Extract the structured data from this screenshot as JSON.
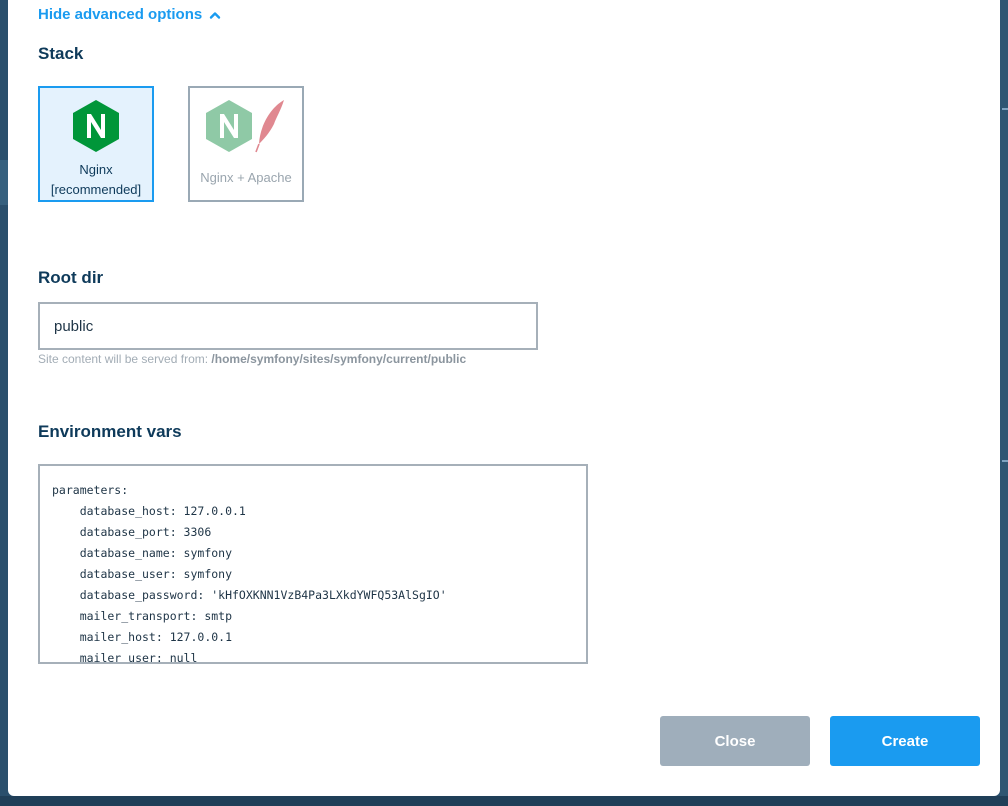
{
  "advanced_toggle": {
    "label": "Hide advanced options",
    "icon": "chevron-up-icon"
  },
  "stack": {
    "title": "Stack",
    "options": [
      {
        "label_line1": "Nginx",
        "label_line2": "[recommended]",
        "selected": true,
        "icon": "nginx-icon"
      },
      {
        "label_line1": "Nginx + Apache",
        "selected": false,
        "icon": "nginx-apache-icon"
      }
    ]
  },
  "root_dir": {
    "title": "Root dir",
    "value": "public",
    "hint_prefix": "Site content will be served from:",
    "hint_path": "/home/symfony/sites/symfony/current/public"
  },
  "env": {
    "title": "Environment vars",
    "lines": [
      "parameters:",
      "    database_host: 127.0.0.1",
      "    database_port: 3306",
      "    database_name: symfony",
      "    database_user: symfony",
      "    database_password: 'kHfOXKNN1VzB4Pa3LXkdYWFQ53AlSgIO'",
      "    mailer_transport: smtp",
      "    mailer_host: 127.0.0.1",
      "    mailer_user: null"
    ]
  },
  "buttons": {
    "close": "Close",
    "create": "Create"
  },
  "colors": {
    "accent": "#1a9bf0",
    "title": "#0e3a5a",
    "nginx_green": "#009639",
    "feather_red": "#d65c6c",
    "close_button": "#9faebb"
  }
}
